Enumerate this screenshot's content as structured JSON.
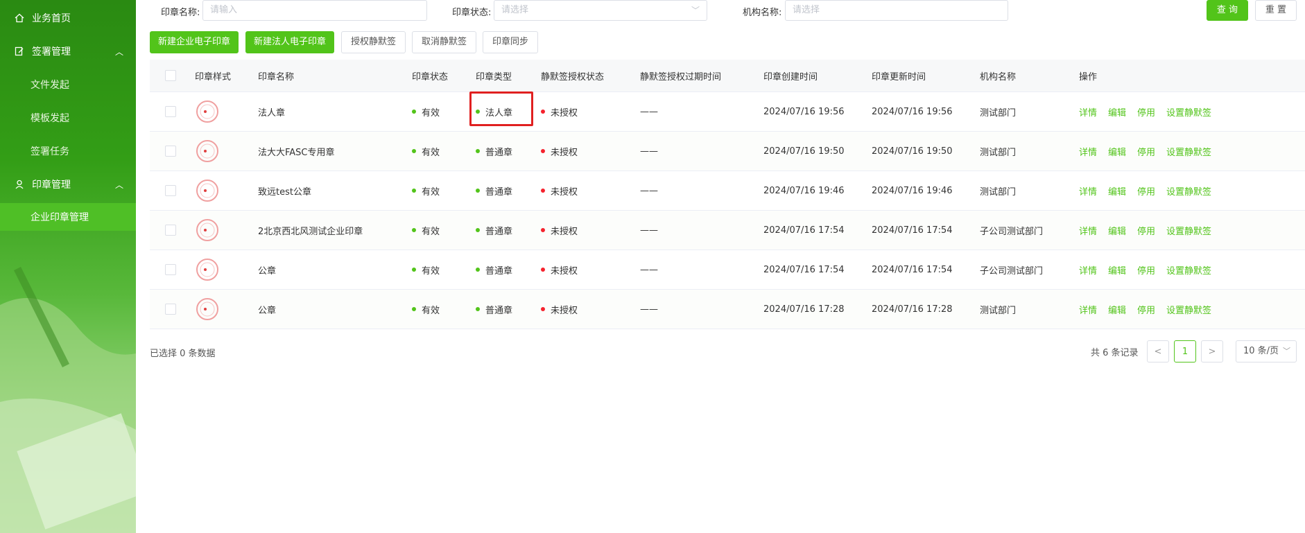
{
  "sidebar": {
    "items": [
      {
        "label": "业务首页",
        "icon": "home-icon"
      },
      {
        "label": "签署管理",
        "icon": "edit-doc-icon",
        "expanded": true
      },
      {
        "label": "文件发起"
      },
      {
        "label": "模板发起"
      },
      {
        "label": "签署任务"
      },
      {
        "label": "印章管理",
        "icon": "user-icon",
        "expanded": true
      },
      {
        "label": "企业印章管理",
        "active": true
      }
    ]
  },
  "filters": {
    "seal_name_label": "印章名称:",
    "seal_name_placeholder": "请输入",
    "seal_status_label": "印章状态:",
    "seal_status_placeholder": "请选择",
    "org_name_label": "机构名称:",
    "org_name_placeholder": "请选择",
    "query_label": "查 询",
    "reset_label": "重 置"
  },
  "toolbar": {
    "new_enterprise": "新建企业电子印章",
    "new_legal": "新建法人电子印章",
    "authorize_silent": "授权静默签",
    "cancel_silent": "取消静默签",
    "sync_seal": "印章同步"
  },
  "table": {
    "headers": [
      "印章样式",
      "印章名称",
      "印章状态",
      "印章类型",
      "静默签授权状态",
      "静默签授权过期时间",
      "印章创建时间",
      "印章更新时间",
      "机构名称",
      "操作"
    ],
    "rows": [
      {
        "name": "法人章",
        "status": "有效",
        "type": "法人章",
        "auth": "未授权",
        "expire": "——",
        "created": "2024/07/16 19:56",
        "updated": "2024/07/16 19:56",
        "org": "测试部门"
      },
      {
        "name": "法大大FASC专用章",
        "status": "有效",
        "type": "普通章",
        "auth": "未授权",
        "expire": "——",
        "created": "2024/07/16 19:50",
        "updated": "2024/07/16 19:50",
        "org": "测试部门"
      },
      {
        "name": "致远test公章",
        "status": "有效",
        "type": "普通章",
        "auth": "未授权",
        "expire": "——",
        "created": "2024/07/16 19:46",
        "updated": "2024/07/16 19:46",
        "org": "测试部门"
      },
      {
        "name": "2北京西北风测试企业印章",
        "status": "有效",
        "type": "普通章",
        "auth": "未授权",
        "expire": "——",
        "created": "2024/07/16 17:54",
        "updated": "2024/07/16 17:54",
        "org": "子公司测试部门"
      },
      {
        "name": "公章",
        "status": "有效",
        "type": "普通章",
        "auth": "未授权",
        "expire": "——",
        "created": "2024/07/16 17:54",
        "updated": "2024/07/16 17:54",
        "org": "子公司测试部门"
      },
      {
        "name": "公章",
        "status": "有效",
        "type": "普通章",
        "auth": "未授权",
        "expire": "——",
        "created": "2024/07/16 17:28",
        "updated": "2024/07/16 17:28",
        "org": "测试部门"
      }
    ],
    "actions": [
      "详情",
      "编辑",
      "停用",
      "设置静默签"
    ]
  },
  "footer": {
    "selected": "已选择 0 条数据",
    "total": "共 6 条记录",
    "prev": "<",
    "current_page": "1",
    "next": ">",
    "page_size": "10 条/页"
  },
  "colors": {
    "accent": "#52c41a",
    "error": "#f5222d",
    "highlight": "#e02020"
  }
}
